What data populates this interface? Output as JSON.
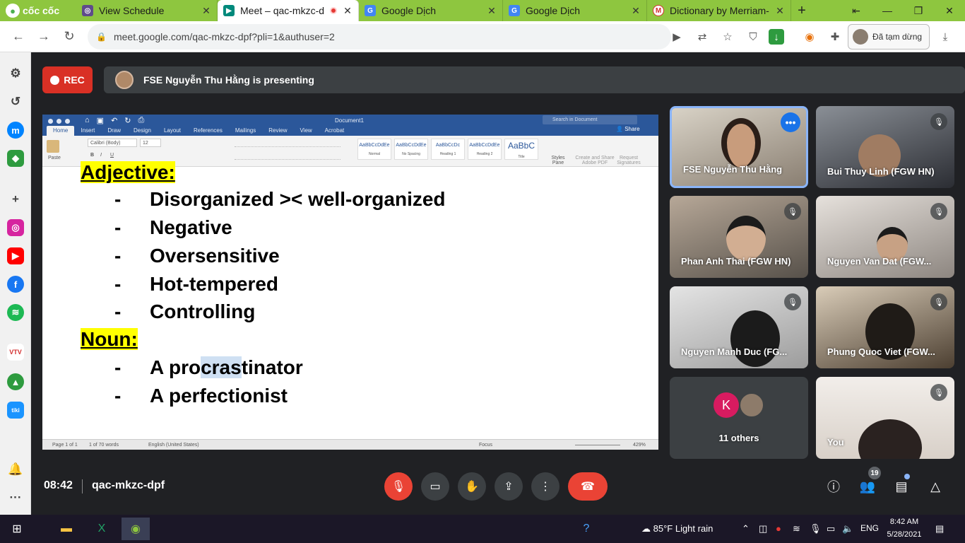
{
  "browser": {
    "brand": "cốc cốc",
    "tabs": [
      {
        "title": "View Schedule",
        "color": "#5f4b8b"
      },
      {
        "title": "Meet – qac-mkzc-dp",
        "color": "#00897b"
      },
      {
        "title": "Google Dịch",
        "color": "#4285f4"
      },
      {
        "title": "Google Dịch",
        "color": "#4285f4"
      },
      {
        "title": "Dictionary by Merriam-",
        "color": "#d32f2f"
      }
    ],
    "url": "meet.google.com/qac-mkzc-dpf?pli=1&authuser=2",
    "profile_button": "Đã tạm dừng"
  },
  "meet": {
    "rec_label": "REC",
    "presenting_text": "FSE Nguyễn Thu Hằng is presenting",
    "time": "08:42",
    "meeting_code": "qac-mkzc-dpf",
    "people_count": "19"
  },
  "word": {
    "doc_title": "Document1",
    "search_placeholder": "Search in Document",
    "share": "Share",
    "ribbon_tabs": [
      "Home",
      "Insert",
      "Draw",
      "Design",
      "Layout",
      "References",
      "Mailings",
      "Review",
      "View",
      "Acrobat"
    ],
    "font": "Calibri (Body)",
    "font_size": "12",
    "styles": [
      {
        "preview": "AaBbCcDdEe",
        "name": "Normal"
      },
      {
        "preview": "AaBbCcDdEe",
        "name": "No Spacing"
      },
      {
        "preview": "AaBbCcDc",
        "name": "Heading 1"
      },
      {
        "preview": "AaBbCcDdEe",
        "name": "Heading 2"
      },
      {
        "preview": "AaBbC",
        "name": "Title"
      }
    ],
    "styles_pane": "Styles Pane",
    "create_pdf": "Create and Share Adobe PDF",
    "request_sig": "Request Signatures",
    "paste": "Paste",
    "status": {
      "page": "Page 1 of 1",
      "words": "1 of 70 words",
      "lang": "English (United States)",
      "focus": "Focus",
      "zoom": "429%"
    },
    "content": {
      "heading1": "Adjective:",
      "adjectives": [
        "Disorganized >< well-organized",
        "Negative",
        "Oversensitive",
        "Hot-tempered",
        "Controlling"
      ],
      "heading2": "Noun:",
      "noun1_a": "A pro",
      "noun1_b": "cras",
      "noun1_c": "tinator",
      "noun2": "A perfectionist",
      "bullet": "-"
    }
  },
  "participants": [
    {
      "name": "FSE Nguyễn Thu Hằng"
    },
    {
      "name": "Bui Thuy Linh (FGW HN)"
    },
    {
      "name": "Phan Anh Thai (FGW HN)"
    },
    {
      "name": "Nguyen Van Dat (FGW..."
    },
    {
      "name": "Nguyen Manh Duc (FG..."
    },
    {
      "name": "Phung Quoc Viet (FGW..."
    },
    {
      "name": "11 others",
      "initial": "K"
    },
    {
      "name": "You"
    }
  ],
  "taskbar": {
    "weather": "85°F  Light rain",
    "lang": "ENG",
    "time": "8:42 AM",
    "date": "5/28/2021"
  }
}
